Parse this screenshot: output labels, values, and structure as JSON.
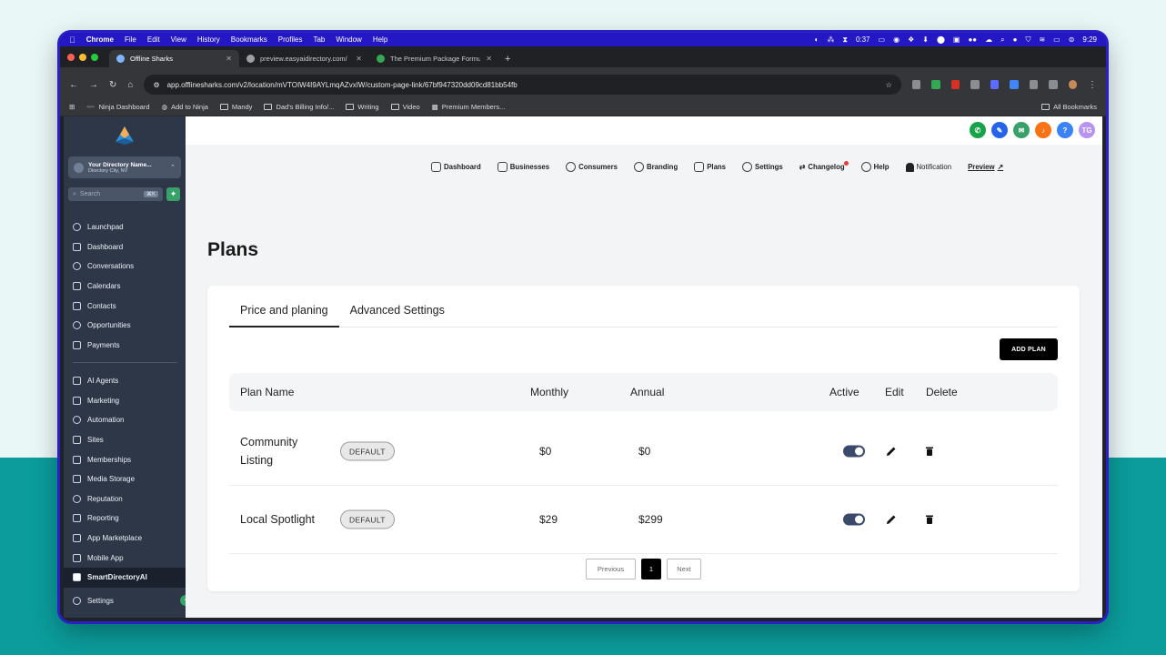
{
  "menubar": {
    "app": "Chrome",
    "items": [
      "File",
      "Edit",
      "View",
      "History",
      "Bookmarks",
      "Profiles",
      "Tab",
      "Window",
      "Help"
    ],
    "timer": "0:37",
    "time": "9:29"
  },
  "browser": {
    "tabs": [
      {
        "label": "Offline Sharks",
        "active": true
      },
      {
        "label": "preview.easyaidirectory.com/",
        "active": false
      },
      {
        "label": "The Premium Package Formu...",
        "active": false
      }
    ],
    "url": "app.offlinesharks.com/v2/location/mVTOIW4I9AYLmqAZvxIW/custom-page-link/67bf947320dd09cd81bb54fb",
    "bookmarks": [
      "Ninja Dashboard",
      "Add to Ninja",
      "Mandy",
      "Dad's Billing Info/...",
      "Writing",
      "Video",
      "Premium Members..."
    ],
    "all_bookmarks": "All Bookmarks"
  },
  "sidebar": {
    "account_name": "Your Directory Name...",
    "account_location": "Directory City, NV",
    "search_placeholder": "Search",
    "search_kbd": "⌘K",
    "nav_top": [
      "Launchpad",
      "Dashboard",
      "Conversations",
      "Calendars",
      "Contacts",
      "Opportunities",
      "Payments"
    ],
    "nav_bottom": [
      "AI Agents",
      "Marketing",
      "Automation",
      "Sites",
      "Memberships",
      "Media Storage",
      "Reputation",
      "Reporting",
      "App Marketplace",
      "Mobile App",
      "SmartDirectoryAI"
    ],
    "settings": "Settings"
  },
  "topbar": {
    "avatar_initials": "TG",
    "help_label": "?"
  },
  "menu": {
    "dashboard": "Dashboard",
    "businesses": "Businesses",
    "consumers": "Consumers",
    "branding": "Branding",
    "plans": "Plans",
    "settings": "Settings",
    "changelog": "Changelog",
    "help": "Help",
    "notification": "Notification",
    "preview": "Preview"
  },
  "page": {
    "title": "Plans",
    "tabs": [
      "Price and planing",
      "Advanced Settings"
    ],
    "add_plan": "ADD PLAN",
    "columns": {
      "plan_name": "Plan Name",
      "monthly": "Monthly",
      "annual": "Annual",
      "active": "Active",
      "edit": "Edit",
      "delete": "Delete"
    },
    "rows": [
      {
        "name": "Community Listing",
        "badge": "DEFAULT",
        "monthly": "$0",
        "annual": "$0",
        "active": true
      },
      {
        "name": "Local Spotlight",
        "badge": "DEFAULT",
        "monthly": "$29",
        "annual": "$299",
        "active": true
      }
    ],
    "pager": {
      "previous": "Previous",
      "page": "1",
      "next": "Next"
    }
  },
  "colors": {
    "sidebar": "#2d3748",
    "menubar": "#2417c4",
    "toggle_on": "#3b4a6b",
    "teal_background": "#0b9c9b"
  }
}
